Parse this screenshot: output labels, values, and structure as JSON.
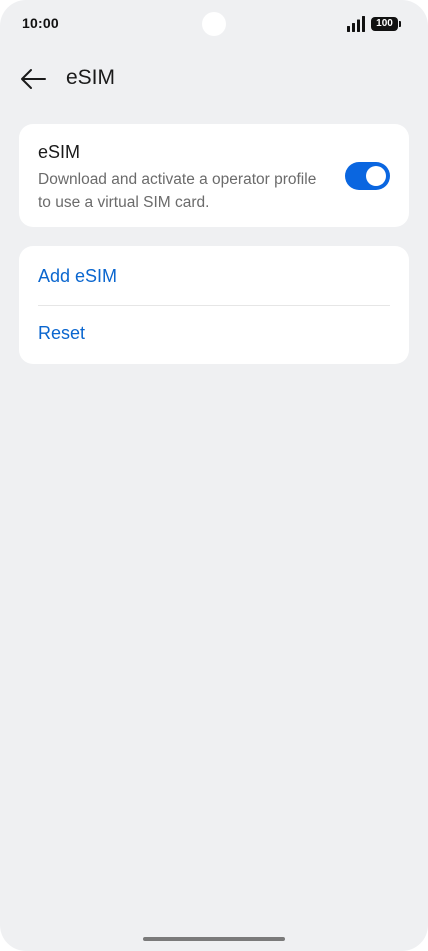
{
  "status_bar": {
    "time": "10:00",
    "battery": "100",
    "icons": [
      "signal-icon",
      "battery-icon"
    ]
  },
  "header": {
    "back_icon": "arrow-left-icon",
    "title": "eSIM"
  },
  "esim_card": {
    "title": "eSIM",
    "description": "Download and activate a operator profile to use a virtual SIM card.",
    "toggle_on": true,
    "toggle_color": "#0a66e0"
  },
  "actions": {
    "add_label": "Add eSIM",
    "reset_label": "Reset",
    "link_color": "#0a66cf"
  },
  "colors": {
    "background": "#eff0f2",
    "card": "#ffffff"
  }
}
